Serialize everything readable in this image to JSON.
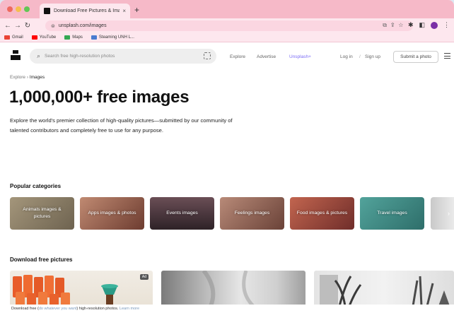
{
  "browser": {
    "tab_title": "Download Free Pictures & Ima",
    "tab_close": "×",
    "new_tab": "+",
    "url": "unsplash.com/images",
    "bookmarks": [
      {
        "label": "Gmail",
        "color": "#ea4335"
      },
      {
        "label": "YouTube",
        "color": "#ff0000"
      },
      {
        "label": "Maps",
        "color": "#34a853"
      },
      {
        "label": "Steaming UNH L...",
        "color": "#4a7bd0"
      }
    ]
  },
  "header": {
    "search_placeholder": "Search free high-resolution photos",
    "nav": {
      "explore": "Explore",
      "advertise": "Advertise",
      "unsplash_plus": "Unsplash+",
      "login": "Log in",
      "divider": "/",
      "signup": "Sign up",
      "submit": "Submit a photo"
    },
    "accent_color": "#7b6cf6"
  },
  "breadcrumb": {
    "root": "Explore",
    "separator": " › ",
    "current": "Images"
  },
  "hero": {
    "title": "1,000,000+ free images",
    "description": "Explore the world's premier collection of high-quality pictures—submitted by our community of talented contributors and completely free to use for any purpose."
  },
  "popular": {
    "title": "Popular categories",
    "categories": [
      {
        "label": "Animals images & pictures",
        "color": "#8d7c63"
      },
      {
        "label": "Apps images & photos",
        "color": "#a8705a"
      },
      {
        "label": "Events images",
        "color": "#4d3a44"
      },
      {
        "label": "Feelings images",
        "color": "#9a6c5e"
      },
      {
        "label": "Food images & pictures",
        "color": "#a8544a"
      },
      {
        "label": "Travel images",
        "color": "#3e8c86"
      }
    ],
    "next_icon": "›"
  },
  "download": {
    "title": "Download free pictures",
    "ad_badge": "Ad"
  },
  "footer": {
    "prefix": "Download free (",
    "link": "do whatever you want",
    "suffix": ") high-resolution photos.",
    "learn_more": "Learn more"
  }
}
